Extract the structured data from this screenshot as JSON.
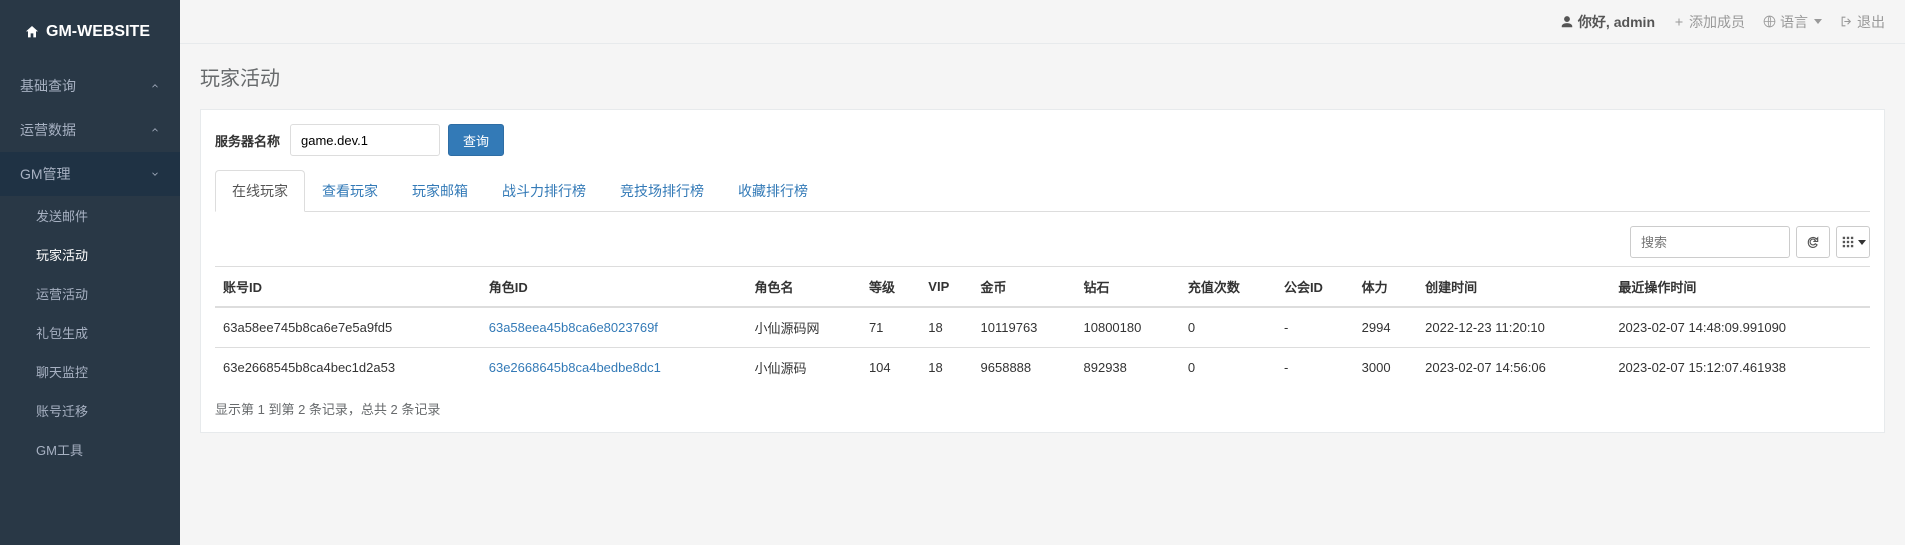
{
  "brand": "GM-WEBSITE",
  "topbar": {
    "greeting_prefix": "你好, ",
    "username": "admin",
    "add_member": "添加成员",
    "language": "语言",
    "logout": "退出"
  },
  "sidebar": {
    "groups": [
      {
        "label": "基础查询",
        "open": false,
        "chev": "up"
      },
      {
        "label": "运营数据",
        "open": false,
        "chev": "up"
      },
      {
        "label": "GM管理",
        "open": true,
        "chev": "down",
        "items": [
          {
            "label": "发送邮件"
          },
          {
            "label": "玩家活动",
            "active": true
          },
          {
            "label": "运营活动"
          },
          {
            "label": "礼包生成"
          },
          {
            "label": "聊天监控"
          },
          {
            "label": "账号迁移"
          },
          {
            "label": "GM工具"
          }
        ]
      }
    ]
  },
  "page": {
    "title": "玩家活动",
    "filter": {
      "label": "服务器名称",
      "value": "game.dev.1",
      "submit": "查询"
    },
    "tabs": [
      {
        "label": "在线玩家",
        "active": true
      },
      {
        "label": "查看玩家"
      },
      {
        "label": "玩家邮箱"
      },
      {
        "label": "战斗力排行榜"
      },
      {
        "label": "竞技场排行榜"
      },
      {
        "label": "收藏排行榜"
      }
    ],
    "search_placeholder": "搜索",
    "columns": [
      "账号ID",
      "角色ID",
      "角色名",
      "等级",
      "VIP",
      "金币",
      "钻石",
      "充值次数",
      "公会ID",
      "体力",
      "创建时间",
      "最近操作时间"
    ],
    "rows": [
      {
        "account": "63a58ee745b8ca6e7e5a9fd5",
        "role_id": "63a58eea45b8ca6e8023769f",
        "role_name": "小仙源码网",
        "level": "71",
        "vip": "18",
        "gold": "10119763",
        "diamond": "10800180",
        "recharge": "0",
        "guild": "-",
        "stamina": "2994",
        "created": "2022-12-23 11:20:10",
        "last_op": "2023-02-07 14:48:09.991090"
      },
      {
        "account": "63e2668545b8ca4bec1d2a53",
        "role_id": "63e2668645b8ca4bedbe8dc1",
        "role_name": "小仙源码",
        "level": "104",
        "vip": "18",
        "gold": "9658888",
        "diamond": "892938",
        "recharge": "0",
        "guild": "-",
        "stamina": "3000",
        "created": "2023-02-07 14:56:06",
        "last_op": "2023-02-07 15:12:07.461938"
      }
    ],
    "footer": "显示第 1 到第 2 条记录，总共 2 条记录"
  }
}
